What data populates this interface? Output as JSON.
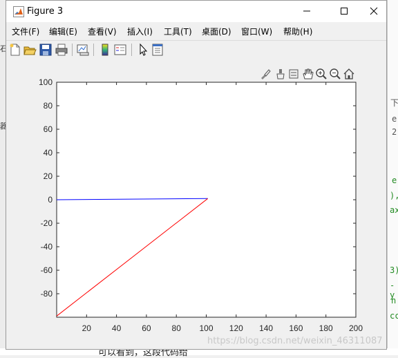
{
  "window": {
    "title": "Figure 3",
    "minimize_glyph": "—",
    "close_glyph": "✕"
  },
  "menu": {
    "items": [
      {
        "label": "文件(F)"
      },
      {
        "label": "编辑(E)"
      },
      {
        "label": "查看(V)"
      },
      {
        "label": "插入(I)"
      },
      {
        "label": "工具(T)"
      },
      {
        "label": "桌面(D)"
      },
      {
        "label": "窗口(W)"
      },
      {
        "label": "帮助(H)"
      }
    ]
  },
  "toolbar": {
    "buttons": [
      "new-figure-icon",
      "open-file-icon",
      "save-icon",
      "print-icon",
      "link-plot-icon",
      "colorbar-icon",
      "legend-icon",
      "edit-plot-icon",
      "property-inspector-icon"
    ]
  },
  "axes_toolbar": {
    "buttons": [
      "brush-icon",
      "data-cursor-icon",
      "linked-icon",
      "pan-icon",
      "zoom-in-icon",
      "zoom-out-icon",
      "home-icon"
    ]
  },
  "colors": {
    "blue_line": "#0000ff",
    "red_line": "#ff0000",
    "axes_bg": "#ffffff",
    "figure_bg": "#f0f0f0"
  },
  "chart_data": {
    "type": "line",
    "xlim": [
      0,
      200
    ],
    "ylim": [
      -100,
      100
    ],
    "xticks": [
      20,
      40,
      60,
      80,
      100,
      120,
      140,
      160,
      180,
      200
    ],
    "yticks": [
      100,
      80,
      60,
      40,
      20,
      0,
      -20,
      -40,
      -60,
      -80
    ],
    "grid": false,
    "series": [
      {
        "color": "#0000ff",
        "x": [
          0,
          101
        ],
        "y": [
          0,
          1
        ]
      },
      {
        "color": "#ff0000",
        "x": [
          0,
          101
        ],
        "y": [
          -99,
          1
        ]
      }
    ]
  },
  "background": {
    "left_fragments": [
      "石",
      "器"
    ],
    "right_fragments": [
      {
        "text": "下",
        "color": "gray"
      },
      {
        "text": "e",
        "color": "gray"
      },
      {
        "text": "2",
        "color": "gray"
      },
      {
        "text": "e",
        "color": "green"
      },
      {
        "text": "),",
        "color": "green"
      },
      {
        "text": "ax",
        "color": "green"
      },
      {
        "text": "3)",
        "color": "green"
      },
      {
        "text": "-y",
        "color": "green"
      },
      {
        "text": "n",
        "color": "green"
      },
      {
        "text": "cc",
        "color": "green"
      }
    ],
    "bottom_text": "可以看到，这段代码给",
    "watermark": "https://blog.csdn.net/weixin_46311087"
  }
}
